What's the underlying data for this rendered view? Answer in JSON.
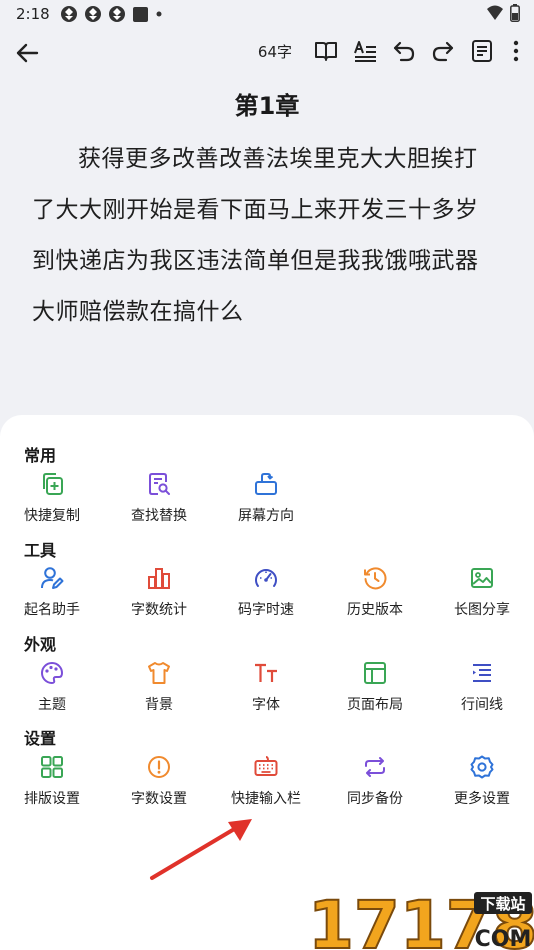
{
  "status_bar": {
    "time": "2:18",
    "icons": [
      "app-icon",
      "app-icon",
      "app-icon",
      "square-icon",
      "dot-icon"
    ],
    "right_icons": [
      "wifi-icon",
      "battery-icon"
    ]
  },
  "toolbar": {
    "word_count": "64字",
    "icons": [
      "back-arrow-icon",
      "book-icon",
      "text-format-icon",
      "undo-icon",
      "redo-icon",
      "document-icon",
      "more-vertical-icon"
    ]
  },
  "chapter": {
    "title": "第1章",
    "body": "获得更多改善改善法埃里克大大胆挨打了大大刚开始是看下面马上来开发三十多岁到快递店为我区违法简单但是我我饿哦武器大师赔偿款在搞什么"
  },
  "menu": {
    "sections": [
      {
        "title": "常用",
        "items": [
          {
            "label": "快捷复制",
            "icon": "copy-add-icon",
            "color": "#3aa655"
          },
          {
            "label": "查找替换",
            "icon": "search-doc-icon",
            "color": "#7b4fd9"
          },
          {
            "label": "屏幕方向",
            "icon": "rotate-screen-icon",
            "color": "#2f73d8"
          }
        ]
      },
      {
        "title": "工具",
        "items": [
          {
            "label": "起名助手",
            "icon": "user-edit-icon",
            "color": "#2f73d8"
          },
          {
            "label": "字数统计",
            "icon": "bar-chart-icon",
            "color": "#e04b3a"
          },
          {
            "label": "码字时速",
            "icon": "speedometer-icon",
            "color": "#3f4fc4"
          },
          {
            "label": "历史版本",
            "icon": "history-clock-icon",
            "color": "#f08a2e"
          },
          {
            "label": "长图分享",
            "icon": "image-icon",
            "color": "#3aa655"
          }
        ]
      },
      {
        "title": "外观",
        "items": [
          {
            "label": "主题",
            "icon": "palette-icon",
            "color": "#7b4fd9"
          },
          {
            "label": "背景",
            "icon": "tshirt-icon",
            "color": "#f08a2e"
          },
          {
            "label": "字体",
            "icon": "font-icon",
            "color": "#e04b3a"
          },
          {
            "label": "页面布局",
            "icon": "layout-icon",
            "color": "#3aa655"
          },
          {
            "label": "行间线",
            "icon": "line-spacing-icon",
            "color": "#3f4fc4"
          }
        ]
      },
      {
        "title": "设置",
        "items": [
          {
            "label": "排版设置",
            "icon": "grid-layout-icon",
            "color": "#3aa655"
          },
          {
            "label": "字数设置",
            "icon": "alert-circle-icon",
            "color": "#f08a2e"
          },
          {
            "label": "快捷输入栏",
            "icon": "keyboard-icon",
            "color": "#e04b3a"
          },
          {
            "label": "同步备份",
            "icon": "sync-icon",
            "color": "#7b4fd9"
          },
          {
            "label": "更多设置",
            "icon": "gear-icon",
            "color": "#2f73d8"
          }
        ]
      }
    ]
  },
  "watermark": {
    "text": "17178",
    "badge": "下载站",
    "domain": "COM"
  }
}
